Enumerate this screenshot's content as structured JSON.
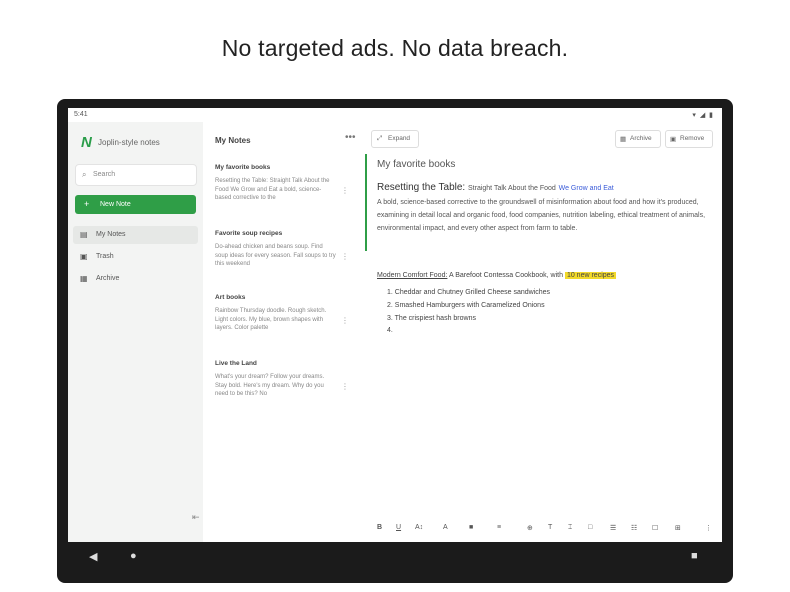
{
  "headline": "No targeted ads. No data breach.",
  "status": {
    "time": "5:41",
    "icons": "▾ ◢ ▮"
  },
  "nav": {
    "back": "◀",
    "home": "●",
    "recents": "■"
  },
  "sidebar": {
    "logo_glyph": "N",
    "app_name": "Joplin-style notes",
    "search_placeholder": "Search",
    "new_note_label": "New Note",
    "items": [
      {
        "icon": "▤",
        "label": "My Notes"
      },
      {
        "icon": "▣",
        "label": "Trash"
      },
      {
        "icon": "▦",
        "label": "Archive"
      }
    ],
    "collapse_icon": "⇤"
  },
  "notes": {
    "title": "My Notes",
    "more": "•••",
    "cards": [
      {
        "title": "My favorite books",
        "preview": "Resetting the Table: Straight Talk About the Food We Grow and Eat a bold, science-based corrective to the"
      },
      {
        "title": "Favorite soup recipes",
        "preview": "Do-ahead chicken and beans soup. Find soup ideas for every season. Fall soups to try this weekend"
      },
      {
        "title": "Art books",
        "preview": "Rainbow Thursday doodle. Rough sketch. Light colors. My blue, brown shapes with layers. Color palette"
      },
      {
        "title": "Live the Land",
        "preview": "What's your dream? Follow your dreams. Stay bold. Here's my dream. Why do you need to be this? No"
      }
    ]
  },
  "editor": {
    "expand_label": "Expand",
    "archive_label": "Archive",
    "remove_label": "Remove",
    "doc_title": "My favorite books",
    "heading": "Resetting the Table:",
    "heading_sub": "Straight Talk About the Food",
    "heading_link": "We Grow and Eat",
    "paragraph": "A bold, science-based corrective to the groundswell of misinformation about food and how it's produced, examining in detail local and organic food, food companies, nutrition labeling, ethical treatment of animals, environmental impact, and every other aspect from farm to table.",
    "comfort_link": "Modern Comfort Food:",
    "comfort_rest": "A Barefoot Contessa Cookbook, with",
    "comfort_highlight": "10 new recipes",
    "list": [
      "1.  Cheddar and Chutney Grilled Cheese sandwiches",
      "2.  Smashed Hamburgers with Caramelized Onions",
      "3.  The crispiest hash browns",
      "4."
    ],
    "toolbar": [
      "B",
      "U",
      "A↕",
      "A",
      "■",
      "≡",
      "⊕",
      "T",
      "⌶",
      "□",
      "☰",
      "☷",
      "☐",
      "⋮"
    ]
  }
}
